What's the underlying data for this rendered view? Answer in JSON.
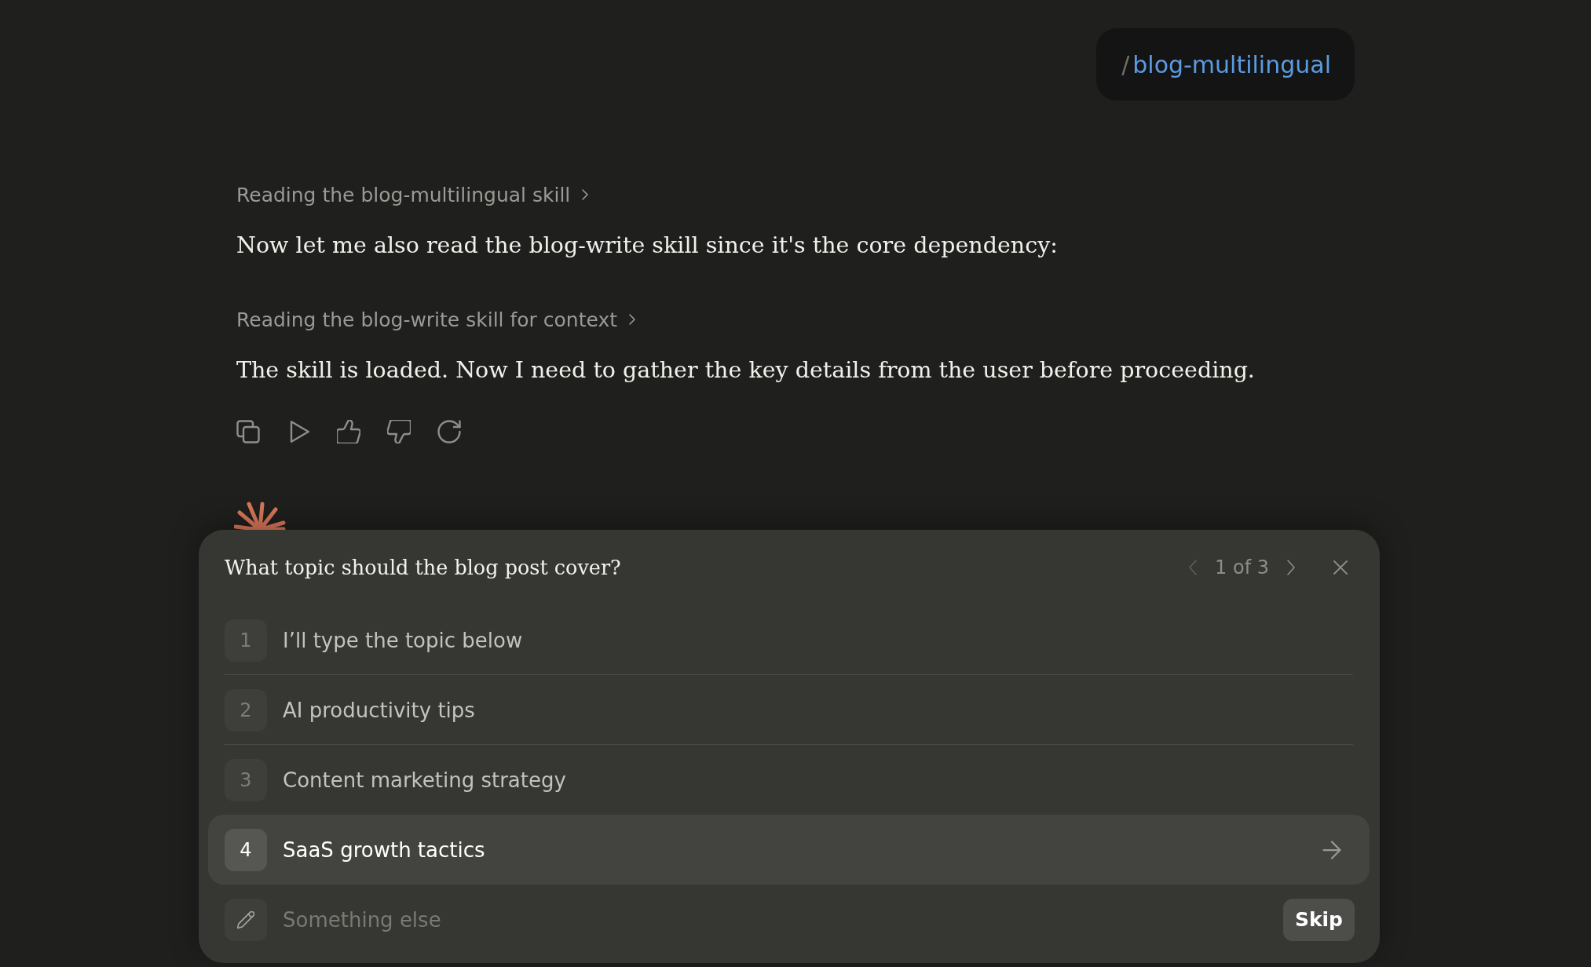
{
  "user_message": {
    "slash": "/",
    "command": "blog-multilingual"
  },
  "transcript": [
    {
      "kind": "step",
      "text": "Reading the blog-multilingual skill"
    },
    {
      "kind": "message",
      "text": "Now let me also read the blog-write skill since it's the core dependency:"
    },
    {
      "kind": "step",
      "text": "Reading the blog-write skill for context"
    },
    {
      "kind": "message",
      "text": "The skill is loaded. Now I need to gather the key details from the user before proceeding."
    }
  ],
  "question": {
    "title": "What topic should the blog post cover?",
    "pager": {
      "text": "1 of 3",
      "prev_disabled": true
    },
    "options": [
      {
        "number": "1",
        "label": "I’ll type the topic below",
        "selected": false
      },
      {
        "number": "2",
        "label": "AI productivity tips",
        "selected": false
      },
      {
        "number": "3",
        "label": "Content marketing strategy",
        "selected": false
      },
      {
        "number": "4",
        "label": "SaaS growth tactics",
        "selected": true
      }
    ],
    "other": {
      "placeholder": "Something else"
    },
    "skip": "Skip"
  }
}
